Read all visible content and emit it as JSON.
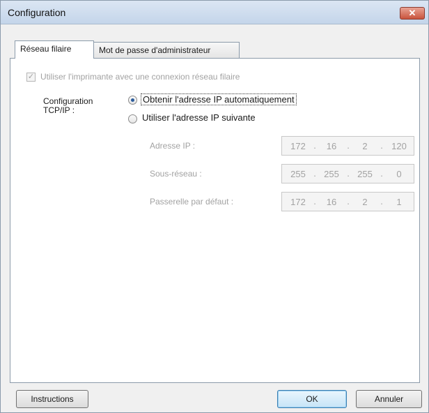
{
  "window": {
    "title": "Configuration",
    "close_glyph": "✕"
  },
  "tabs": [
    {
      "label": "Réseau filaire",
      "active": true
    },
    {
      "label": "Mot de passe d'administrateur",
      "active": false
    }
  ],
  "wired": {
    "use_printer_label": "Utiliser l'imprimante avec une connexion réseau filaire",
    "use_printer_checked": true,
    "check_glyph": "✓",
    "tcp_label_line1": "Configuration",
    "tcp_label_line2": "TCP/IP :",
    "radio_auto_label": "Obtenir l'adresse IP automatiquement",
    "radio_auto_selected": true,
    "radio_manual_label": "Utiliser l'adresse IP suivante",
    "radio_manual_selected": false,
    "ip_address": {
      "label": "Adresse IP :",
      "octets": [
        "172",
        "16",
        "2",
        "120"
      ]
    },
    "subnet": {
      "label": "Sous-réseau :",
      "octets": [
        "255",
        "255",
        "255",
        "0"
      ]
    },
    "gateway": {
      "label": "Passerelle par défaut :",
      "octets": [
        "172",
        "16",
        "2",
        "1"
      ]
    },
    "separator": "."
  },
  "buttons": {
    "instructions": "Instructions",
    "ok": "OK",
    "cancel": "Annuler"
  }
}
